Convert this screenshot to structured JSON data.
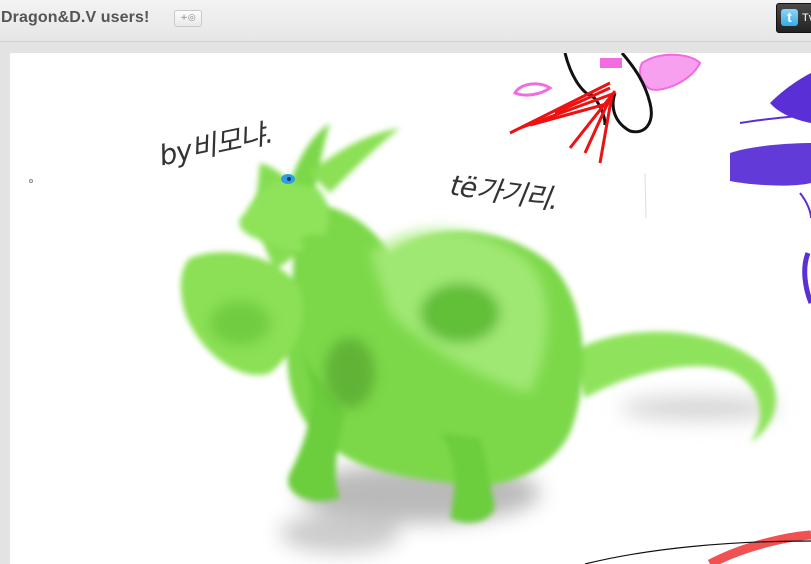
{
  "header": {
    "title": "Dragon&D.V users!",
    "plus_label": "+◎",
    "twitter_icon": "t",
    "twitter_label": "Tv"
  },
  "canvas": {
    "scribble_1": "by비모냐.",
    "scribble_2": "të가기리."
  },
  "colors": {
    "dragon": "#7fdc4a",
    "dragon_dark": "#4da82a",
    "scribble_red": "#ee1111",
    "scribble_pink": "#f26be0",
    "scribble_purple": "#5a2fd6"
  }
}
